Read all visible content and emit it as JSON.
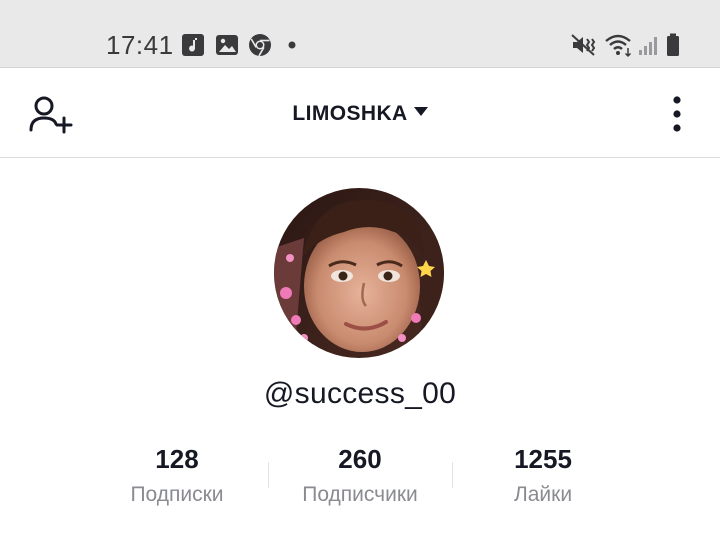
{
  "status_bar": {
    "time": "17:41",
    "left_icons": [
      "music-note-icon",
      "gallery-icon",
      "chrome-icon",
      "notification-dot-icon"
    ],
    "right_icons": [
      "vibrate-mute-icon",
      "wifi-icon",
      "signal-icon",
      "battery-icon"
    ]
  },
  "header": {
    "username": "LIMOSHKA",
    "left_icon": "add-friend-icon",
    "right_icon": "more-vertical-icon"
  },
  "profile": {
    "handle": "@success_00",
    "stats": [
      {
        "value": "128",
        "label": "Подписки"
      },
      {
        "value": "260",
        "label": "Подписчики"
      },
      {
        "value": "1255",
        "label": "Лайки"
      }
    ]
  }
}
